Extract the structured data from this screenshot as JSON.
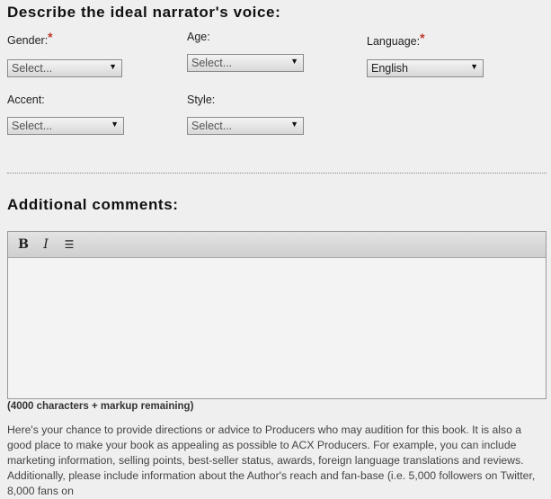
{
  "narrator": {
    "title": "Describe the ideal narrator's voice:",
    "required_mark": "*",
    "gender": {
      "label": "Gender:",
      "value": "Select..."
    },
    "age": {
      "label": "Age:",
      "value": "Select..."
    },
    "language": {
      "label": "Language:",
      "value": "English"
    },
    "accent": {
      "label": "Accent:",
      "value": "Select..."
    },
    "style": {
      "label": "Style:",
      "value": "Select..."
    }
  },
  "comments": {
    "title": "Additional comments:",
    "toolbar": {
      "bold": "B",
      "italic": "I",
      "list": "☰"
    },
    "remaining": "(4000 characters + markup remaining)",
    "help_text": "Here's your chance to provide directions or advice to Producers who may audition for this book. It is also a good place to make your book as appealing as possible to ACX Producers. For example, you can include marketing information, selling points, best-seller status, awards, foreign language translations and reviews. Additionally, please include information about the Author's reach and fan-base (i.e. 5,000 followers on Twitter, 8,000 fans on"
  },
  "icons": {
    "dropdown": "chevron-down-icon",
    "bold": "bold-icon",
    "italic": "italic-icon",
    "list": "bulleted-list-icon"
  },
  "colors": {
    "required": "#c0392b",
    "background": "#efefef"
  }
}
